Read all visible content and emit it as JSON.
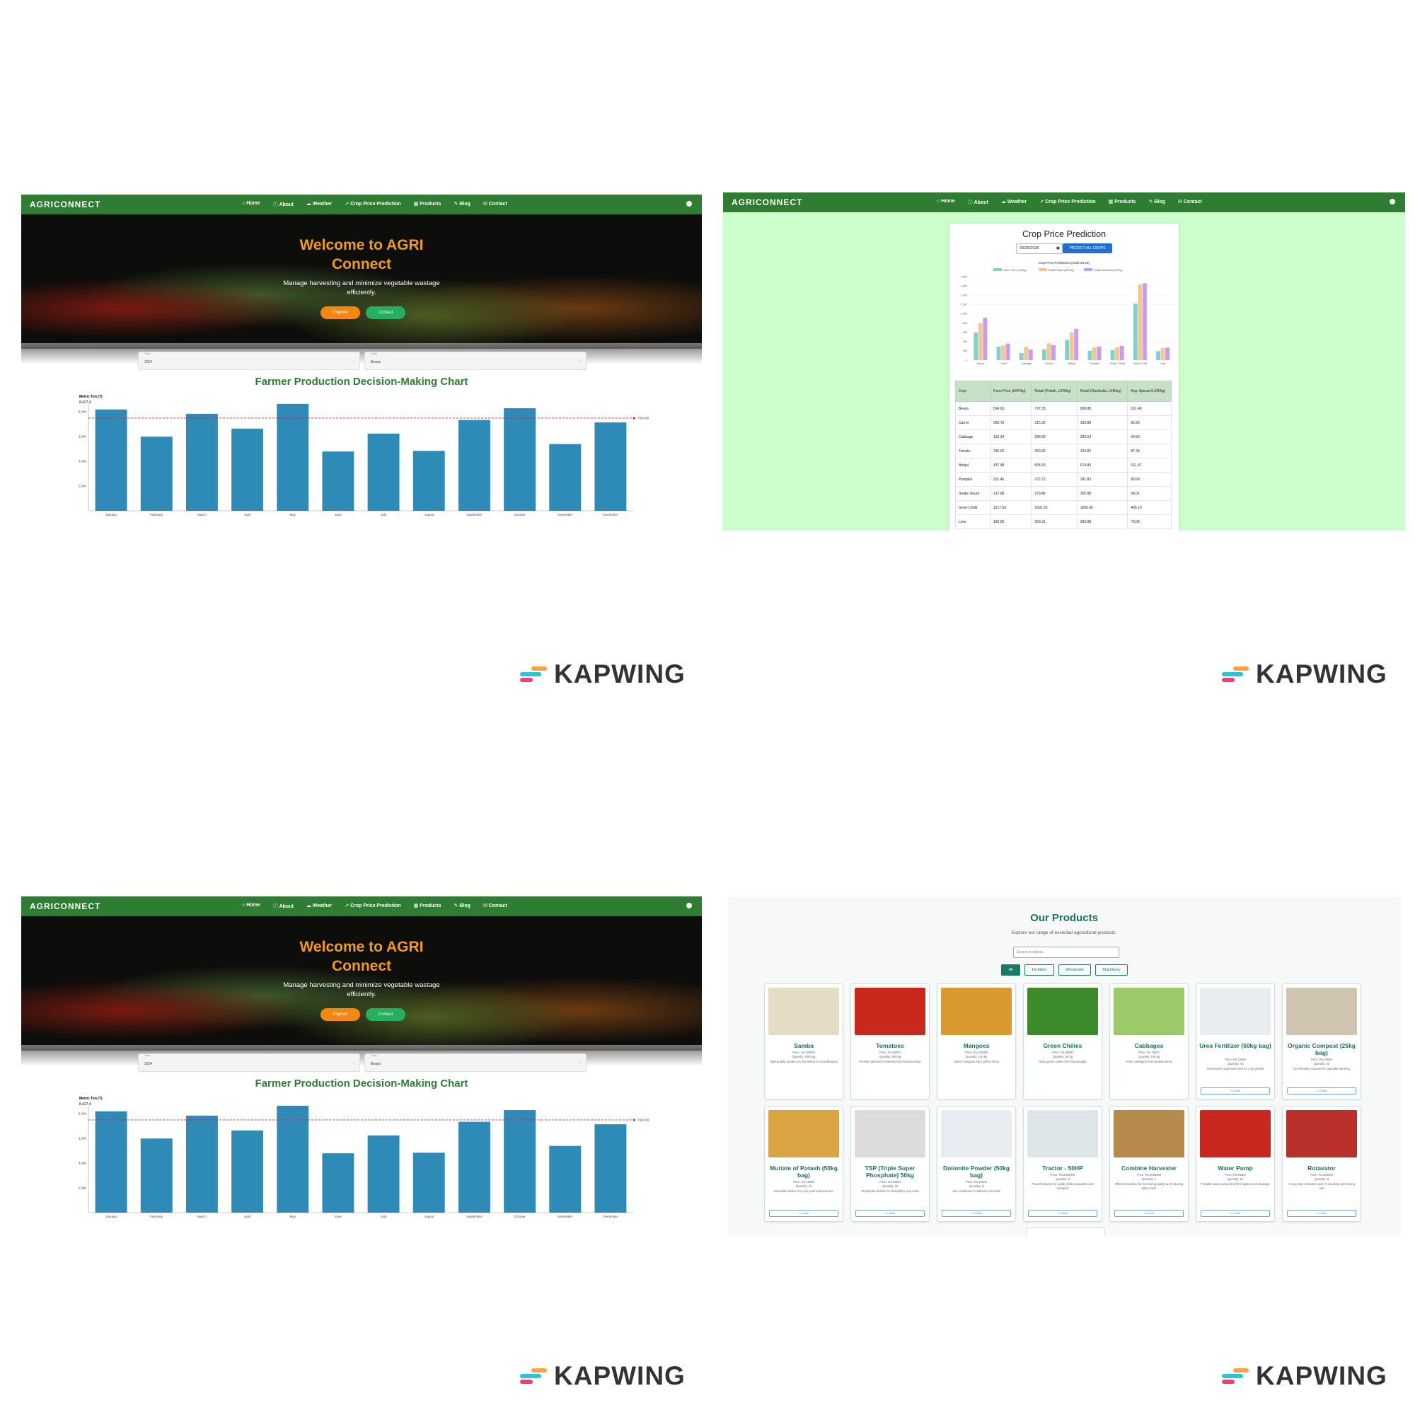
{
  "home": {
    "brand": "AGRICONNECT",
    "nav": [
      "Home",
      "About",
      "Weather",
      "Crop Price Prediction",
      "Products",
      "Blog",
      "Contact"
    ],
    "hero_title_line1": "Welcome to AGRI",
    "hero_title_line2": "Connect",
    "hero_sub_line1": "Manage harvesting and minimize vegetable wastage",
    "hero_sub_line2": "efficiently.",
    "explore": "Explore",
    "contact": "Contact",
    "year_label": "Year",
    "year_value": "2024",
    "crop_label": "Crop",
    "crop_value": "Beans",
    "chart_title": "Farmer Production Decision-Making Chart"
  },
  "production_chart": {
    "type": "bar",
    "ylabel": "Metric Ton (T)",
    "top_label": "8,427.4",
    "threshold": 7500,
    "threshold_label": "7500.00",
    "ylim": [
      0,
      8700
    ],
    "yticks": [
      "2,000",
      "4,000",
      "6,000",
      "8,000"
    ],
    "categories": [
      "January",
      "February",
      "March",
      "April",
      "May",
      "June",
      "July",
      "August",
      "September",
      "October",
      "November",
      "December"
    ],
    "values": [
      8200,
      6000,
      7850,
      6650,
      8650,
      4800,
      6250,
      4850,
      7350,
      8300,
      5400,
      7150
    ],
    "color": "#2e8bb8"
  },
  "prediction": {
    "brand": "AGRICONNECT",
    "title": "Crop Price Prediction",
    "date": "09/25/2025",
    "button": "PREDICT ALL CROPS",
    "chart_title": "Crop Price Predictions (2025-09-25)",
    "legend": [
      "Farm Price (LKR/kg)",
      "Retail Pettah (LKR/kg)",
      "Retail Dambulla (LKR/kg)"
    ],
    "headers": [
      "Crop",
      "Farm Price (LKR/kg)",
      "Retail (Pettah, LKR/kg)",
      "Retail (Dambulla, LKR/kg)",
      "Avg. Spread (LKR/kg)"
    ],
    "rows": [
      [
        "Beans",
        "594.63",
        "797.35",
        "909.88",
        "161.48"
      ],
      [
        "Carrot",
        "290.75",
        "315.32",
        "355.88",
        "65.55"
      ],
      [
        "Cabbage",
        "152.34",
        "286.69",
        "226.64",
        "64.56"
      ],
      [
        "Tomato",
        "235.02",
        "360.32",
        "324.82",
        "87.46"
      ],
      [
        "Brinjal",
        "437.48",
        "595.65",
        "674.84",
        "161.47"
      ],
      [
        "Pumpkin",
        "201.46",
        "272.72",
        "291.83",
        "83.69"
      ],
      [
        "Snake Gourd",
        "217.68",
        "279.46",
        "305.88",
        "99.01"
      ],
      [
        "Green Chilli",
        "1217.93",
        "1632.30",
        "1656.42",
        "405.10"
      ],
      [
        "Lime",
        "192.00",
        "263.31",
        "269.88",
        "73.09"
      ]
    ]
  },
  "prediction_chart": {
    "type": "bar",
    "categories": [
      "Beans",
      "Carrot",
      "Cabbage",
      "Tomato",
      "Brinjal",
      "Pumpkin",
      "Snake Gourd",
      "Green Chilli",
      "Lime"
    ],
    "series": [
      {
        "name": "Farm Price (LKR/kg)",
        "values": [
          594.63,
          290.75,
          152.34,
          235.02,
          437.48,
          201.46,
          217.68,
          1217.93,
          192.0
        ],
        "color": "#7fd1cf"
      },
      {
        "name": "Retail Pettah (LKR/kg)",
        "values": [
          797.35,
          315.32,
          286.69,
          360.32,
          595.65,
          272.72,
          279.46,
          1632.3,
          263.31
        ],
        "color": "#f7c58f"
      },
      {
        "name": "Retail Dambulla (LKR/kg)",
        "values": [
          909.88,
          355.88,
          226.64,
          324.82,
          674.84,
          291.83,
          305.88,
          1656.42,
          269.88
        ],
        "color": "#c49cf0"
      }
    ],
    "ylim": [
      0,
      1800
    ],
    "yticks": [
      "0",
      "200",
      "400",
      "600",
      "800",
      "1,000",
      "1,200",
      "1,400",
      "1,600",
      "1,800"
    ]
  },
  "products": {
    "title": "Our Products",
    "subtitle": "Explore our range of essential agricultural products.",
    "search_placeholder": "Search products...",
    "filters": [
      "All",
      "Fertilizer",
      "Wholesale",
      "Machinery"
    ],
    "chat": "Chat",
    "items": [
      {
        "name": "Samba",
        "price": "Price: Rs.100000",
        "qty": "Quantity: 1000 kg",
        "desc": "High-quality Samba rice harvested in Anuradhapura",
        "color": "#e6dcc6"
      },
      {
        "name": "Tomatoes",
        "price": "Price: Rs.80000",
        "qty": "Quantity: 500 kg",
        "desc": "Freshly harvested tomatoes from Nuwara Eliya",
        "color": "#c9281c"
      },
      {
        "name": "Mangoes",
        "price": "Price: Rs.150000",
        "qty": "Quantity: 100 kg",
        "desc": "Sweet mangoes from Jaffna farms",
        "color": "#d89a2e"
      },
      {
        "name": "Green Chilies",
        "price": "Price: Rs.30000",
        "qty": "Quantity: 50 kg",
        "desc": "Spicy green chilies from Kurunegala",
        "color": "#3d8a2a"
      },
      {
        "name": "Cabbages",
        "price": "Price: Rs.75000",
        "qty": "Quantity: 120 kg",
        "desc": "Fresh cabbages from Badulla farms",
        "color": "#9cc96a"
      },
      {
        "name": "Urea Fertilizer (50kg bag)",
        "price": "Price: Rs.12000",
        "qty": "Quantity: 40",
        "desc": "Government approved urea for crop growth",
        "color": "#e8eef0"
      },
      {
        "name": "Organic Compost (25kg bag)",
        "price": "Price: Rs.20000",
        "qty": "Quantity: 30",
        "desc": "Eco-friendly compost for vegetable farming",
        "color": "#cfc4b0"
      },
      {
        "name": "Muriate of Potash (50kg bag)",
        "price": "Price: Rs.15000",
        "qty": "Quantity: 15",
        "desc": "Essential fertilizer for crop yield improvement",
        "color": "#d9a441"
      },
      {
        "name": "TSP (Triple Super Phosphate) 50kg",
        "price": "Price: Rs.20000",
        "qty": "Quantity: 10",
        "desc": "Phosphate fertilizer to strengthen crop roots",
        "color": "#dcdcdc"
      },
      {
        "name": "Dolomite Powder (50kg bag)",
        "price": "Price: Rs.10000",
        "qty": "Quantity: 5",
        "desc": "Soil conditioner to balance pH levels",
        "color": "#e9edf2"
      },
      {
        "name": "Tractor - 50HP",
        "price": "Price: Rs.2500000",
        "qty": "Quantity: 5",
        "desc": "Powerful tractor for paddy field preparation and transport",
        "color": "#dfe6ea"
      },
      {
        "name": "Combine Harvester",
        "price": "Price: Rs.8000000",
        "qty": "Quantity: 2",
        "desc": "Efficient machine for harvesting paddy and reducing labor costs",
        "color": "#b68a4a"
      },
      {
        "name": "Water Pump",
        "price": "Price: Rs.95000",
        "qty": "Quantity: 15",
        "desc": "Portable water pump ideal for irrigation and drainage",
        "color": "#c8281e"
      },
      {
        "name": "Rotavator",
        "price": "Price: Rs.300000",
        "qty": "Quantity: 8",
        "desc": "Heavy-duty rotavator used for breaking and mixing soil",
        "color": "#b9302a"
      }
    ]
  },
  "watermark": "KAPWING"
}
